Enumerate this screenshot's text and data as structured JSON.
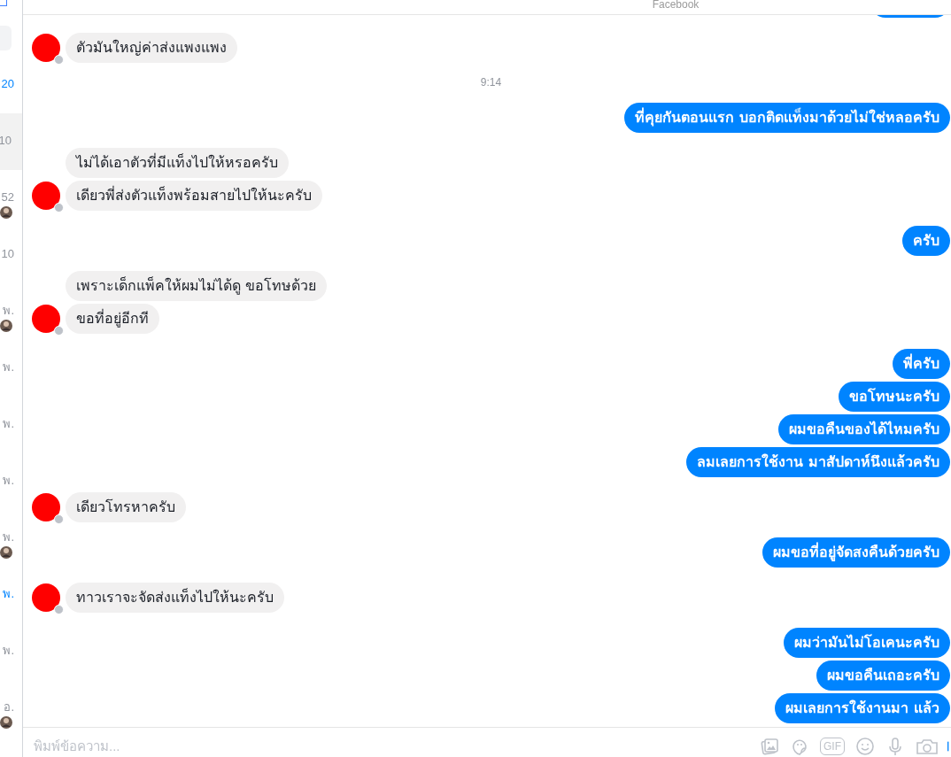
{
  "conversation_list": {
    "items": [
      {
        "time": "20",
        "unread": true,
        "selected": false,
        "avatar": false
      },
      {
        "time": "10",
        "unread": false,
        "selected": true,
        "avatar": false
      },
      {
        "time": "52",
        "unread": false,
        "selected": false,
        "avatar": true
      },
      {
        "time": "10",
        "unread": false,
        "selected": false,
        "avatar": false
      },
      {
        "time": "พ.",
        "unread": false,
        "selected": false,
        "avatar": true
      },
      {
        "time": "พ.",
        "unread": false,
        "selected": false,
        "avatar": false
      },
      {
        "time": "พ.",
        "unread": false,
        "selected": false,
        "avatar": false
      },
      {
        "time": "พ.",
        "unread": false,
        "selected": false,
        "avatar": false
      },
      {
        "time": "พ.",
        "unread": false,
        "selected": false,
        "avatar": true
      },
      {
        "time": "พ.",
        "unread": true,
        "selected": false,
        "avatar": false
      },
      {
        "time": "พ.",
        "unread": false,
        "selected": false,
        "avatar": false
      },
      {
        "time": "อ.",
        "unread": false,
        "selected": false,
        "avatar": true
      }
    ]
  },
  "chat": {
    "header": "Facebook",
    "entries": [
      {
        "kind": "incoming",
        "messages": [
          "ตัวมันใหญ่ค่าส่งแพงแพง"
        ]
      },
      {
        "kind": "time",
        "text": "9:14"
      },
      {
        "kind": "outgoing",
        "messages": [
          "ที่คุยกันตอนแรก บอกติดแท็งมาด้วยไม่ใช่หลอครับ"
        ]
      },
      {
        "kind": "incoming",
        "messages": [
          "ไม่ได้เอาตัวที่มีแท็งไปให้หรอครับ",
          "เดียวพี่ส่งตัวแท็งพร้อมสายไปให้นะครับ"
        ]
      },
      {
        "kind": "outgoing",
        "messages": [
          "ครับ"
        ]
      },
      {
        "kind": "incoming",
        "messages": [
          "เพราะเด็กแพ็คให้ผมไม่ได้ดู ขอโทษด้วย",
          "ขอที่อยู่อีกที"
        ]
      },
      {
        "kind": "outgoing",
        "messages": [
          "พี่ครับ",
          "ขอโทษนะครับ",
          "ผมขอคืนของได้ไหมครับ",
          "ลมเลยการใช้งาน มาสัปดาห์นึงแล้วครับ"
        ]
      },
      {
        "kind": "incoming",
        "messages": [
          "เดียวโทรหาครับ"
        ]
      },
      {
        "kind": "outgoing",
        "messages": [
          "ผมขอที่อยู่จัดสงคืนด้วยครับ"
        ]
      },
      {
        "kind": "incoming",
        "messages": [
          "ทาวเราจะจัดส่งแท็งไปให้นะครับ"
        ]
      },
      {
        "kind": "outgoing",
        "messages": [
          "ผมว่ามันไม่โอเคนะครับ",
          "ผมขอคืนเถอะครับ",
          "ผมเลยการใช้งานมา แล้ว"
        ]
      }
    ],
    "composer": {
      "placeholder": "พิมพ์ข้อความ...",
      "gif_label": "GIF"
    }
  }
}
